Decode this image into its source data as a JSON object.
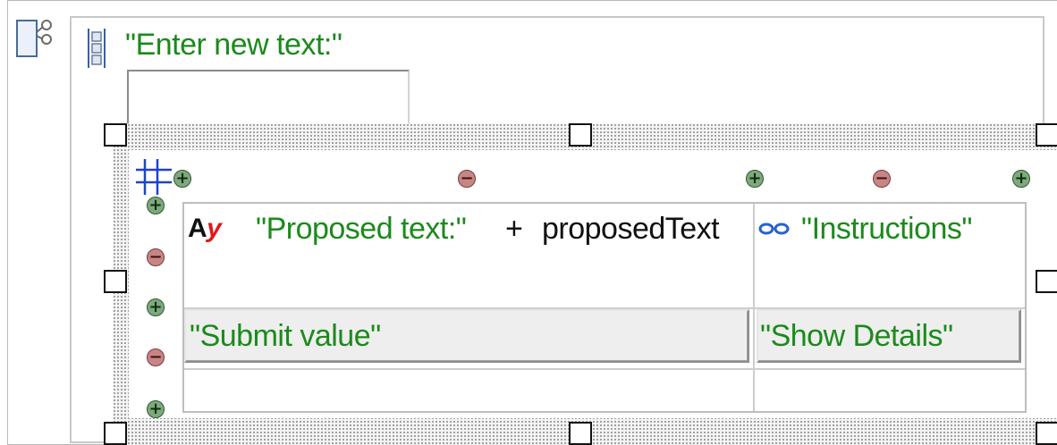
{
  "form": {
    "label_text": "\"Enter new text:\"",
    "text_field_value": ""
  },
  "table": {
    "cells": {
      "proposed_prefix": "Ay",
      "proposed_literal": "\"Proposed text:\"",
      "proposed_operator": "+",
      "proposed_variable": "proposedText",
      "instructions": "\"Instructions\"",
      "submit_button": "\"Submit value\"",
      "details_button": "\"Show Details\""
    }
  },
  "glyphs": {
    "add": "+",
    "remove": "−"
  },
  "colors": {
    "string_literal": "#1b8a1b",
    "add_control": "#7fa87f",
    "remove_control": "#c78686",
    "link_icon": "#2a5fd0",
    "frame_border": "#c8c8c8"
  },
  "icons": [
    "form-component-icon",
    "layout-icon",
    "label-icon",
    "link-icon",
    "table-move-icon",
    "add-column-icon",
    "remove-column-icon",
    "add-row-icon",
    "remove-row-icon"
  ]
}
